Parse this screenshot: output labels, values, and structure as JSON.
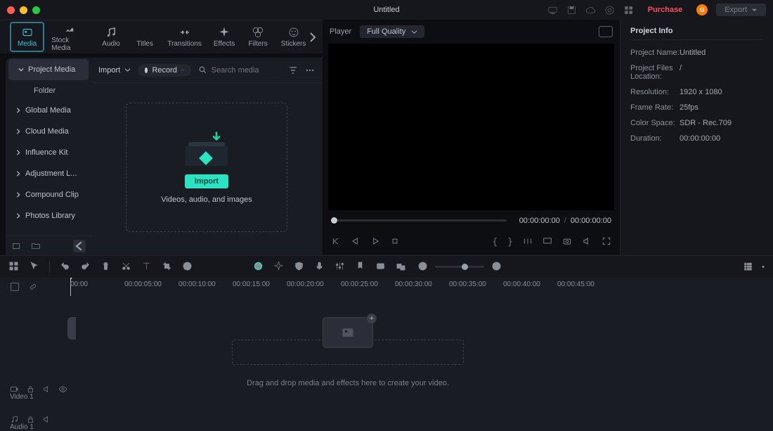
{
  "titlebar": {
    "title": "Untitled",
    "purchase": "Purchase",
    "avatar": "G",
    "export": "Export"
  },
  "modeTabs": [
    "Media",
    "Stock Media",
    "Audio",
    "Titles",
    "Transitions",
    "Effects",
    "Filters",
    "Stickers"
  ],
  "sidebar": {
    "items": [
      "Project Media",
      "Global Media",
      "Cloud Media",
      "Influence Kit",
      "Adjustment L...",
      "Compound Clip",
      "Photos Library"
    ],
    "sub": "Folder"
  },
  "mediaToolbar": {
    "import": "Import",
    "record": "Record",
    "searchPlaceholder": "Search media"
  },
  "dropzone": {
    "button": "Import",
    "subtitle": "Videos, audio, and images"
  },
  "player": {
    "label": "Player",
    "quality": "Full Quality",
    "time_current": "00:00:00:00",
    "time_total": "00:00:00:00"
  },
  "info": {
    "title": "Project Info",
    "rows": [
      {
        "k": "Project Name:",
        "v": "Untitled"
      },
      {
        "k": "Project Files Location:",
        "v": "/"
      },
      {
        "k": "Resolution:",
        "v": "1920 x 1080"
      },
      {
        "k": "Frame Rate:",
        "v": "25fps"
      },
      {
        "k": "Color Space:",
        "v": "SDR - Rec.709"
      },
      {
        "k": "Duration:",
        "v": "00:00:00:00"
      }
    ]
  },
  "ruler": [
    "00:00",
    "00:00:05:00",
    "00:00:10:00",
    "00:00:15:00",
    "00:00:20:00",
    "00:00:25:00",
    "00:00:30:00",
    "00:00:35:00",
    "00:00:40:00",
    "00:00:45:00"
  ],
  "timeline": {
    "dropText": "Drag and drop media and effects here to create your video.",
    "video1": "Video 1",
    "audio1": "Audio 1"
  }
}
